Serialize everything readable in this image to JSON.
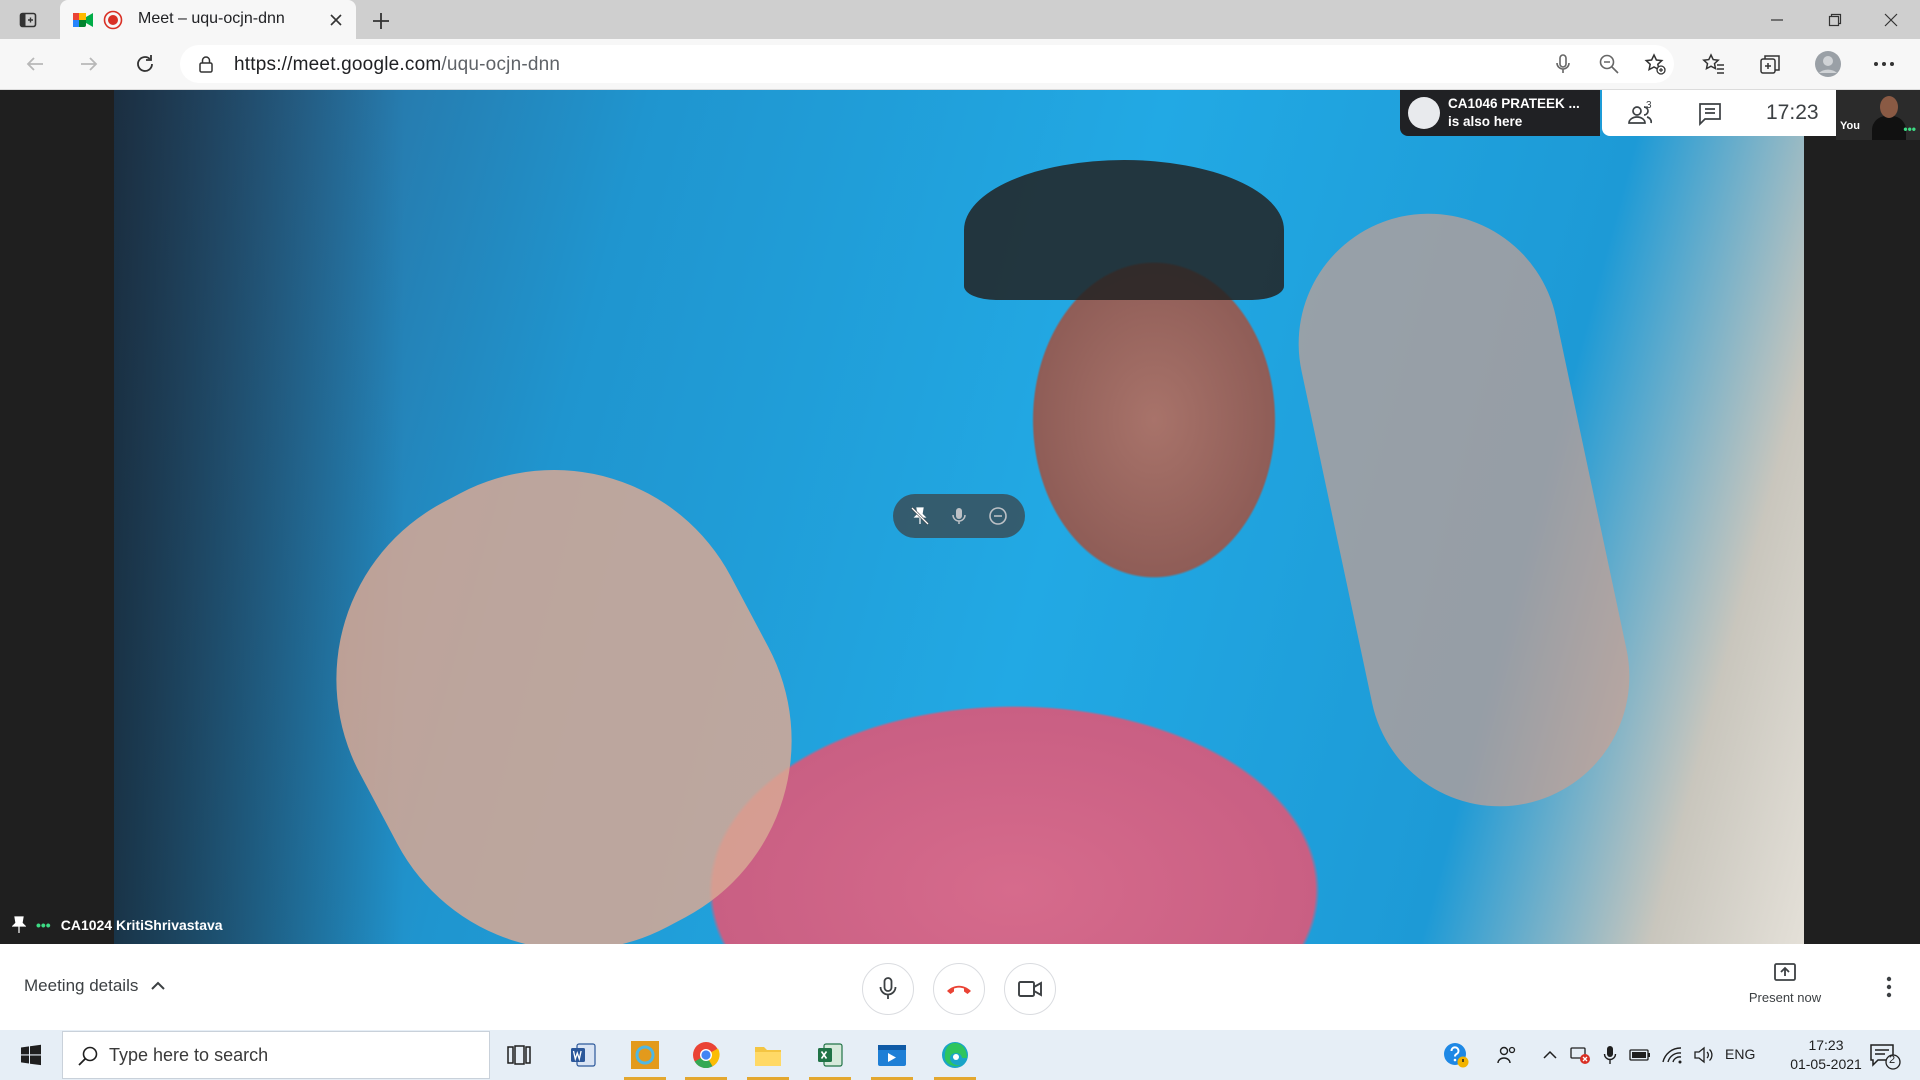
{
  "browser": {
    "tab_title": "Meet – uqu-ocjn-dnn",
    "url_host": "https://meet.google.com",
    "url_path": "/uqu-ocjn-dnn"
  },
  "meeting": {
    "toast_name": "CA1046 PRATEEK ...",
    "toast_sub": "is also here",
    "people_count": "3",
    "clock": "17:23",
    "self_label": "You",
    "self_more": "•••",
    "participant_name": "CA1024 KritiShrivastava",
    "participant_more": "•••",
    "meeting_details_label": "Meeting details",
    "present_now_label": "Present now"
  },
  "taskbar": {
    "search_placeholder": "Type here to search",
    "language": "ENG",
    "time": "17:23",
    "date": "01-05-2021",
    "notification_count": "2"
  },
  "colors": {
    "meet_red": "#ea4335",
    "taskbar_bg": "#e6eef6",
    "stage_bg": "#1f1f1f",
    "accent_green": "#3ddc84"
  }
}
